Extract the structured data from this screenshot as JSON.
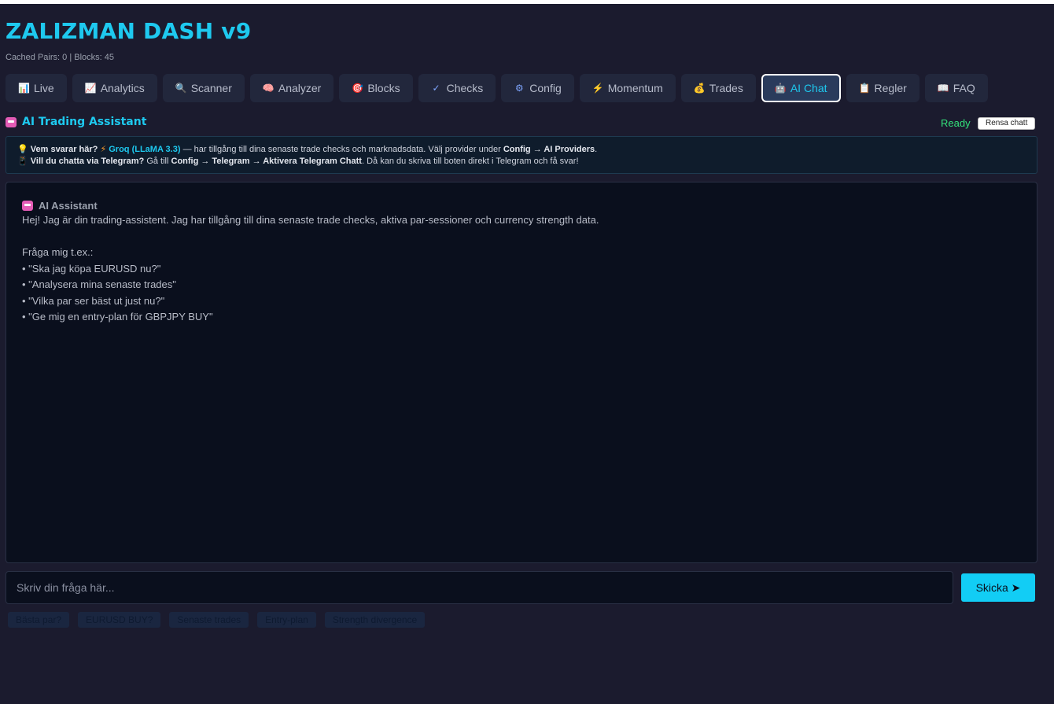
{
  "app": {
    "title": "ZALIZMAN DASH v9",
    "subtitle": "Cached Pairs: 0 | Blocks: 45"
  },
  "tabs": [
    {
      "icon": "📊",
      "label": "Live"
    },
    {
      "icon": "📈",
      "label": "Analytics"
    },
    {
      "icon": "🔍",
      "label": "Scanner"
    },
    {
      "icon": "🧠",
      "label": "Analyzer"
    },
    {
      "icon": "🎯",
      "label": "Blocks"
    },
    {
      "icon": "✓",
      "label": "Checks"
    },
    {
      "icon": "⚙",
      "label": "Config"
    },
    {
      "icon": "⚡",
      "label": "Momentum"
    },
    {
      "icon": "💰",
      "label": "Trades"
    },
    {
      "icon": "🤖",
      "label": "AI Chat",
      "active": true
    },
    {
      "icon": "📋",
      "label": "Regler"
    },
    {
      "icon": "📖",
      "label": "FAQ"
    }
  ],
  "panel": {
    "title": "AI Trading Assistant",
    "status": "Ready",
    "clear_label": "Rensa chatt"
  },
  "info": {
    "q1": "Vem svarar här?",
    "provider": "Groq (LLaMA 3.3)",
    "text1": "— har tillgång till dina senaste trade checks och marknadsdata. Välj provider under",
    "config_path": "Config → AI Providers",
    "q2": "Vill du chatta via Telegram?",
    "text2a": "Gå till",
    "telegram_path": "Config → Telegram → Aktivera Telegram Chatt",
    "text2b": ". Då kan du skriva till boten direkt i Telegram och få svar!"
  },
  "chat": {
    "author": "AI Assistant",
    "lines": [
      "Hej! Jag är din trading-assistent. Jag har tillgång till dina senaste trade checks, aktiva par-sessioner och currency strength data.",
      "",
      "Fråga mig t.ex.:",
      "• \"Ska jag köpa EURUSD nu?\"",
      "• \"Analysera mina senaste trades\"",
      "• \"Vilka par ser bäst ut just nu?\"",
      "• \"Ge mig en entry-plan för GBPJPY BUY\""
    ]
  },
  "input": {
    "placeholder": "Skriv din fråga här...",
    "send_label": "Skicka ➤"
  },
  "chips": [
    "Bästa par?",
    "EURUSD BUY?",
    "Senaste trades",
    "Entry-plan",
    "Strength divergence"
  ],
  "colors": {
    "accent": "#1ec9ef",
    "status_ready": "#33e17a",
    "background": "#1b1b2e",
    "chat_bg": "#0a0f1d"
  }
}
